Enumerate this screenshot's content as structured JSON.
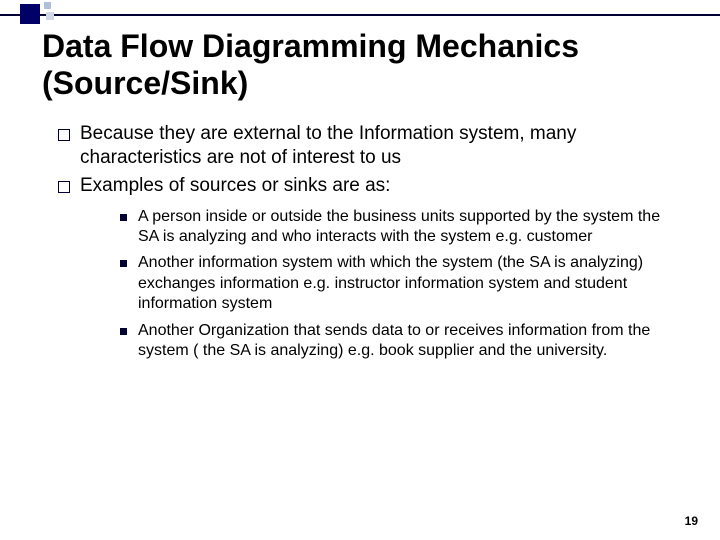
{
  "title": "Data Flow Diagramming Mechanics (Source/Sink)",
  "bullets": {
    "b1": "Because they are external to the Information system, many characteristics are not of interest to us",
    "b2": "Examples of sources or sinks are as:"
  },
  "subbullets": {
    "s1": "A person inside or outside the business units supported by the system the SA is analyzing and who interacts with the system e.g. customer",
    "s2": "Another information system with which the system (the SA is analyzing) exchanges information e.g. instructor information system and student information system",
    "s3": "Another Organization that sends data to or receives information from the system ( the SA is  analyzing) e.g. book supplier and the university."
  },
  "pageNumber": "19"
}
